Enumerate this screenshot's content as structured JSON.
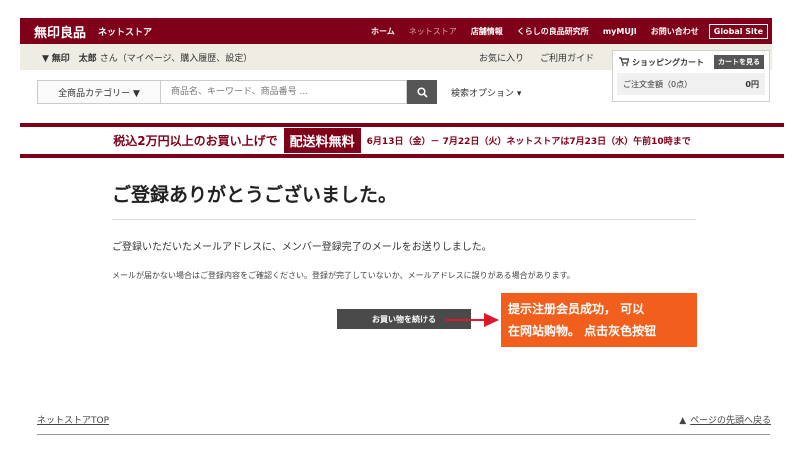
{
  "header": {
    "logo": "無印良品",
    "subtitle": "ネットストア",
    "nav": [
      "ホーム",
      "ネットストア",
      "店舗情報",
      "くらしの良品研究所",
      "myMUJI",
      "お問い合わせ"
    ],
    "global": "Global Site"
  },
  "userbar": {
    "prefix": "▼",
    "name": "無印　太郎",
    "suffix": "さん（マイページ、購入履歴、設定）",
    "favorites": "お気に入り",
    "guide": "ご利用ガイド"
  },
  "cart": {
    "title": "ショッピングカート",
    "view_button": "カートを見る",
    "total_label": "ご注文金額（0点）",
    "total_value": "0円"
  },
  "search": {
    "category": "全商品カテゴリー ▼",
    "placeholder": "商品名、キーワード、商品番号 ...",
    "options": "検索オプション ▾"
  },
  "banner": {
    "lead": "税込2万円以上のお買い上げで",
    "highlight": "配送料無料",
    "period": "6月13日（金）－ 7月22日（火）ネットストアは7月23日（水）午前10時まで"
  },
  "main": {
    "heading": "ご登録ありがとうございました。",
    "message": "ご登録いただいたメールアドレスに、メンバー登録完了のメールをお送りしました。",
    "note": "メールが届かない場合はご登録内容をご確認ください。登録が完了していないか、メールアドレスに誤りがある場合があります。",
    "continue_button": "お買い物を続ける"
  },
  "annotation": {
    "line1": "提示注册会员成功， 可以",
    "line2": "在网站购物。 点击灰色按钮"
  },
  "footer": {
    "top_link": "ネットストアTOP",
    "back_to_top": "ページの先頭へ戻る"
  },
  "colors": {
    "brand": "#7f0019",
    "callout": "#f25f1c",
    "arrow": "#e0182b"
  }
}
